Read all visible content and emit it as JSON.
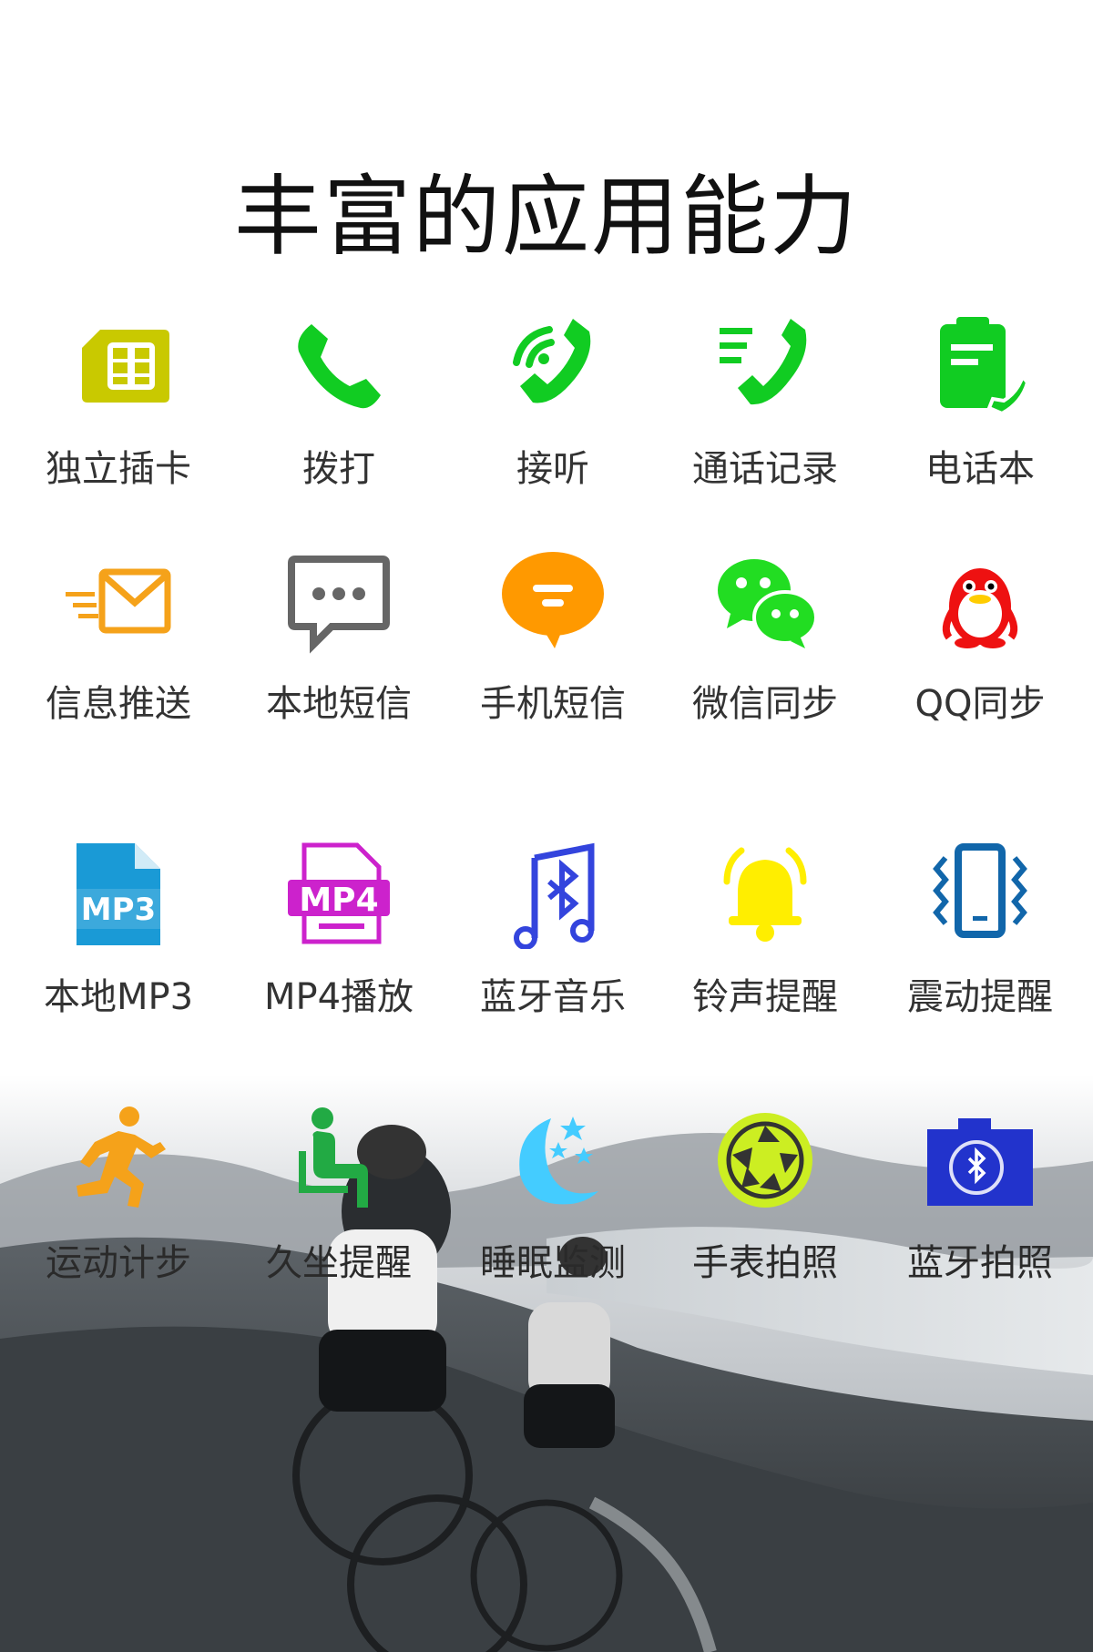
{
  "title": "丰富的应用能力",
  "features": [
    {
      "label": "独立插卡",
      "icon": "sim-card-icon",
      "color": "#c9c900"
    },
    {
      "label": "拨打",
      "icon": "phone-icon",
      "color": "#11cc22"
    },
    {
      "label": "接听",
      "icon": "incoming-call-icon",
      "color": "#11cc22"
    },
    {
      "label": "通话记录",
      "icon": "call-log-icon",
      "color": "#11cc22"
    },
    {
      "label": "电话本",
      "icon": "phonebook-icon",
      "color": "#11cc22"
    },
    {
      "label": "信息推送",
      "icon": "envelope-icon",
      "color": "#f5a21a"
    },
    {
      "label": "本地短信",
      "icon": "chat-bubble-icon",
      "color": "#666666"
    },
    {
      "label": "手机短信",
      "icon": "message-icon",
      "color": "#ff9900"
    },
    {
      "label": "微信同步",
      "icon": "wechat-icon",
      "color": "#22dd22"
    },
    {
      "label": "QQ同步",
      "icon": "qq-penguin-icon",
      "color": "#ee1111"
    },
    {
      "label": "本地MP3",
      "icon": "mp3-file-icon",
      "color": "#1a9ad6"
    },
    {
      "label": "MP4播放",
      "icon": "mp4-file-icon",
      "color": "#cc22cc"
    },
    {
      "label": "蓝牙音乐",
      "icon": "bluetooth-music-icon",
      "color": "#3344dd"
    },
    {
      "label": "铃声提醒",
      "icon": "bell-icon",
      "color": "#ffee00"
    },
    {
      "label": "震动提醒",
      "icon": "vibrate-phone-icon",
      "color": "#1166aa"
    },
    {
      "label": "运动计步",
      "icon": "runner-icon",
      "color": "#f5a21a"
    },
    {
      "label": "久坐提醒",
      "icon": "sitting-person-icon",
      "color": "#22aa44"
    },
    {
      "label": "睡眠监测",
      "icon": "moon-stars-icon",
      "color": "#44ccff"
    },
    {
      "label": "手表拍照",
      "icon": "camera-shutter-icon",
      "color": "#ccee22"
    },
    {
      "label": "蓝牙拍照",
      "icon": "bluetooth-camera-icon",
      "color": "#2233cc"
    }
  ],
  "MP3": "MP3",
  "MP4": "MP4"
}
